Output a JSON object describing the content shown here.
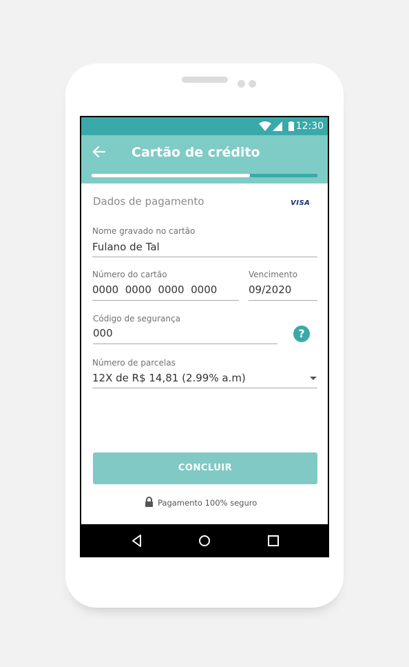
{
  "status_bar": {
    "time": "12:30",
    "icons": [
      "wifi-icon",
      "signal-icon",
      "battery-icon"
    ]
  },
  "app_bar": {
    "title": "Cartão de crédito",
    "back_icon": "arrow-left-icon",
    "progress": 0.7
  },
  "payment": {
    "section_title": "Dados de pagamento",
    "card_brand": "VISA",
    "fields": {
      "name": {
        "label": "Nome gravado no cartão",
        "value": "Fulano de Tal"
      },
      "card_number": {
        "label": "Número do cartão",
        "value": "0000  0000  0000  0000"
      },
      "expiry": {
        "label": "Vencimento",
        "value": "09/2020"
      },
      "cvv": {
        "label": "Código de segurança",
        "value": "000"
      },
      "installments": {
        "label": "Número de parcelas",
        "value": "12X de R$ 14,81 (2.99% a.m)"
      }
    },
    "help_icon": "question-circle-icon",
    "submit_label": "CONCLUIR",
    "secure_text": "Pagamento 100% seguro"
  },
  "colors": {
    "accent": "#3aa9a9",
    "appbar": "#7fcbc6",
    "button": "#80c9c4",
    "visa": "#1a2a78"
  }
}
